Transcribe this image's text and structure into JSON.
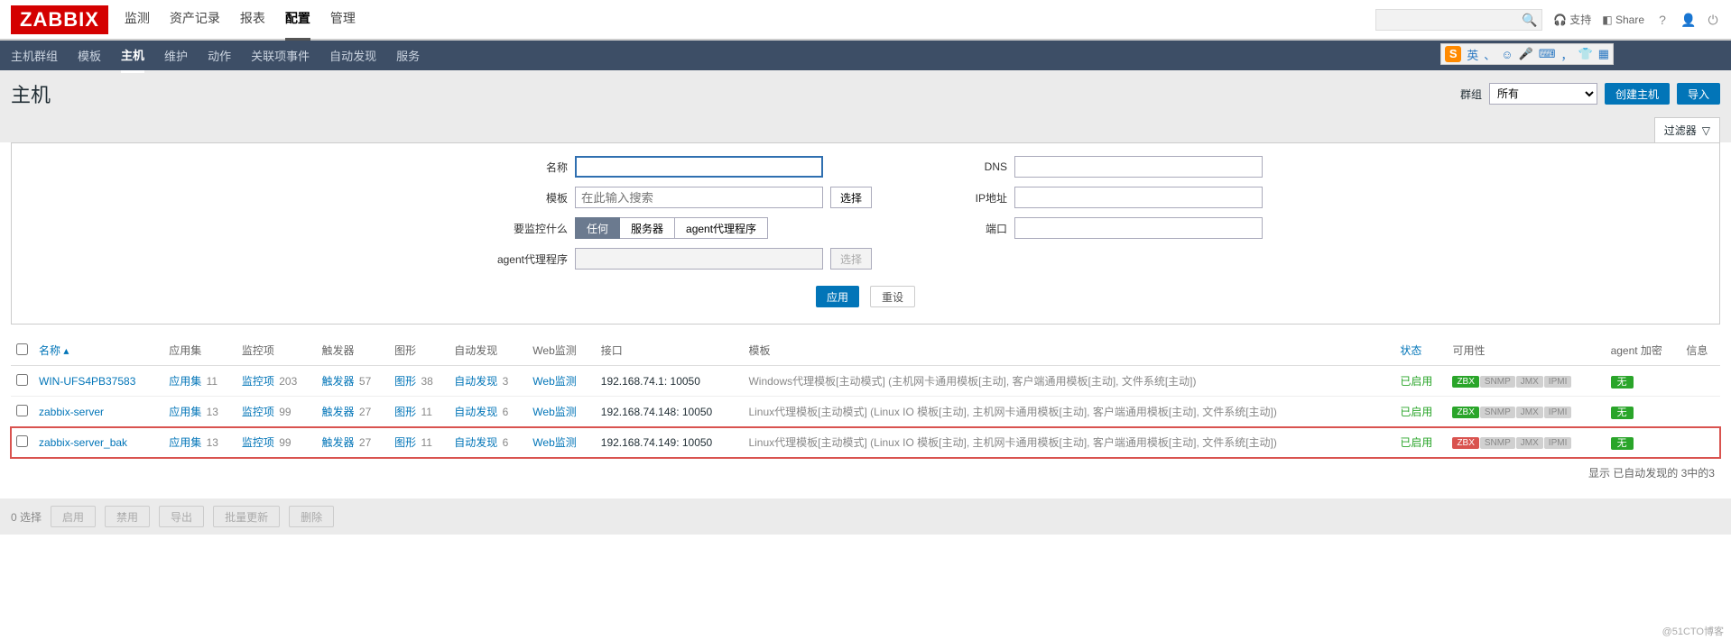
{
  "logo": "ZABBIX",
  "topnav": {
    "items": [
      "监测",
      "资产记录",
      "报表",
      "配置",
      "管理"
    ],
    "active": 3,
    "support": "支持",
    "share": "Share"
  },
  "ime": {
    "lang": "英",
    "punct": "，",
    "sep": "、"
  },
  "subnav": {
    "items": [
      "主机群组",
      "模板",
      "主机",
      "维护",
      "动作",
      "关联项事件",
      "自动发现",
      "服务"
    ],
    "active": 2
  },
  "page": {
    "title": "主机",
    "group_label": "群组",
    "group_value": "所有",
    "create": "创建主机",
    "import": "导入"
  },
  "filter": {
    "tab": "过滤器",
    "name_label": "名称",
    "tpl_label": "模板",
    "tpl_placeholder": "在此输入搜索",
    "tpl_select": "选择",
    "monitor_label": "要监控什么",
    "monitor_opts": [
      "任何",
      "服务器",
      "agent代理程序"
    ],
    "monitor_active": 0,
    "proxy_label": "agent代理程序",
    "proxy_select": "选择",
    "dns_label": "DNS",
    "ip_label": "IP地址",
    "port_label": "端口",
    "apply": "应用",
    "reset": "重设"
  },
  "columns": {
    "name": "名称",
    "apps": "应用集",
    "items": "监控项",
    "triggers": "触发器",
    "graphs": "图形",
    "discovery": "自动发现",
    "web": "Web监测",
    "iface": "接口",
    "templates": "模板",
    "status": "状态",
    "avail": "可用性",
    "agent_enc": "agent 加密",
    "info": "信息"
  },
  "badges": {
    "zbx": "ZBX",
    "snmp": "SNMP",
    "jmx": "JMX",
    "ipmi": "IPMI"
  },
  "enc_none": "无",
  "rows": [
    {
      "name": "WIN-UFS4PB37583",
      "apps": "11",
      "items": "203",
      "triggers": "57",
      "graphs": "38",
      "disc": "3",
      "web": "",
      "iface": "192.168.74.1: 10050",
      "tpl": "Windows代理模板[主动模式] (主机网卡通用模板[主动], 客户端通用模板[主动], 文件系统[主动])",
      "status": "已启用",
      "zbx_ok": true,
      "hl": false
    },
    {
      "name": "zabbix-server",
      "apps": "13",
      "items": "99",
      "triggers": "27",
      "graphs": "11",
      "disc": "6",
      "web": "",
      "iface": "192.168.74.148: 10050",
      "tpl": "Linux代理模板[主动模式] (Linux IO 模板[主动], 主机网卡通用模板[主动], 客户端通用模板[主动], 文件系统[主动])",
      "status": "已启用",
      "zbx_ok": true,
      "hl": false
    },
    {
      "name": "zabbix-server_bak",
      "apps": "13",
      "items": "99",
      "triggers": "27",
      "graphs": "11",
      "disc": "6",
      "web": "",
      "iface": "192.168.74.149: 10050",
      "tpl": "Linux代理模板[主动模式] (Linux IO 模板[主动], 主机网卡通用模板[主动], 客户端通用模板[主动], 文件系统[主动])",
      "status": "已启用",
      "zbx_ok": false,
      "hl": true
    }
  ],
  "table_footer": "显示 已自动发现的 3中的3",
  "footer": {
    "selected": "0 选择",
    "enable": "启用",
    "disable": "禁用",
    "export": "导出",
    "massupdate": "批量更新",
    "delete": "删除"
  },
  "watermark": "@51CTO博客"
}
